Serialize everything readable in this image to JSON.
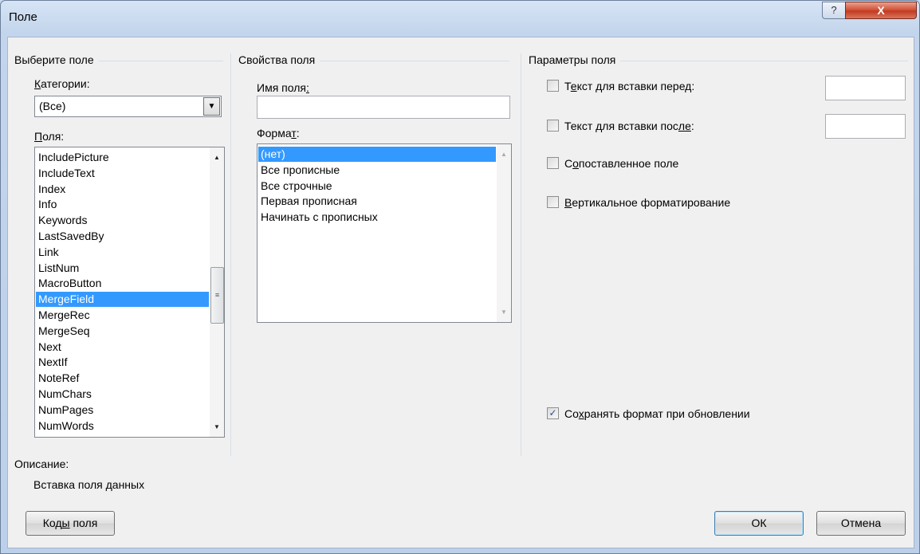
{
  "window": {
    "title": "Поле"
  },
  "choose_field": {
    "group_title": "Выберите поле",
    "categories_label": "Категории:",
    "categories_value": "(Все)",
    "fields_label": "Поля:",
    "fields": [
      "IncludePicture",
      "IncludeText",
      "Index",
      "Info",
      "Keywords",
      "LastSavedBy",
      "Link",
      "ListNum",
      "MacroButton",
      "MergeField",
      "MergeRec",
      "MergeSeq",
      "Next",
      "NextIf",
      "NoteRef",
      "NumChars",
      "NumPages",
      "NumWords"
    ],
    "selected_field": "MergeField"
  },
  "field_props": {
    "group_title": "Свойства поля",
    "field_name_label": "Имя поля:",
    "field_name_value": "",
    "format_label": "Формат:",
    "formats": [
      "(нет)",
      "Все прописные",
      "Все строчные",
      "Первая прописная",
      "Начинать с прописных"
    ],
    "selected_format": "(нет)"
  },
  "field_options": {
    "group_title": "Параметры поля",
    "text_before_label": "Текст для вставки перед:",
    "text_after_label": "Текст для вставки после:",
    "mapped_field_label": "Сопоставленное поле",
    "vertical_format_label": "Вертикальное форматирование",
    "preserve_format_label": "Сохранять формат при обновлении",
    "preserve_format_checked": true
  },
  "description": {
    "label": "Описание:",
    "text": "Вставка поля данных"
  },
  "buttons": {
    "field_codes": "Коды поля",
    "ok": "ОК",
    "cancel": "Отмена",
    "help": "?",
    "close": "X"
  }
}
